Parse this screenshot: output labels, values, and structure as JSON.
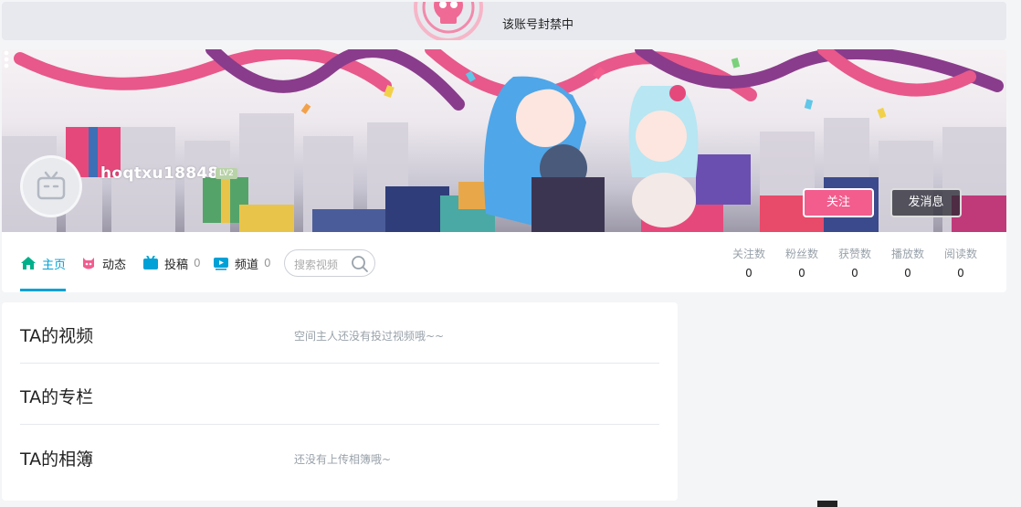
{
  "ban": {
    "text": "该账号封禁中",
    "icon": "skull-icon"
  },
  "profile": {
    "username": "hoqtxu18848",
    "level": "LV2",
    "avatar_icon": "tv-face-icon",
    "follow_label": "关注",
    "message_label": "发消息",
    "more_icon": "more-vertical-icon"
  },
  "nav": {
    "items": [
      {
        "label": "主页",
        "icon": "home-icon",
        "count": ""
      },
      {
        "label": "动态",
        "icon": "dynamic-icon",
        "count": ""
      },
      {
        "label": "投稿",
        "icon": "upload-icon",
        "count": "0"
      },
      {
        "label": "频道",
        "icon": "channel-icon",
        "count": "0"
      }
    ],
    "search_placeholder": "搜索视频"
  },
  "stats": [
    {
      "label": "关注数",
      "value": "0"
    },
    {
      "label": "粉丝数",
      "value": "0"
    },
    {
      "label": "获赞数",
      "value": "0"
    },
    {
      "label": "播放数",
      "value": "0"
    },
    {
      "label": "阅读数",
      "value": "0"
    }
  ],
  "sections": [
    {
      "title": "TA的视频",
      "note": "空间主人还没有投过视频哦~~"
    },
    {
      "title": "TA的专栏",
      "note": ""
    },
    {
      "title": "TA的相簿",
      "note": "还没有上传相簿哦~"
    }
  ],
  "colors": {
    "accent": "#00a1d6",
    "follow": "#f25d8e"
  }
}
